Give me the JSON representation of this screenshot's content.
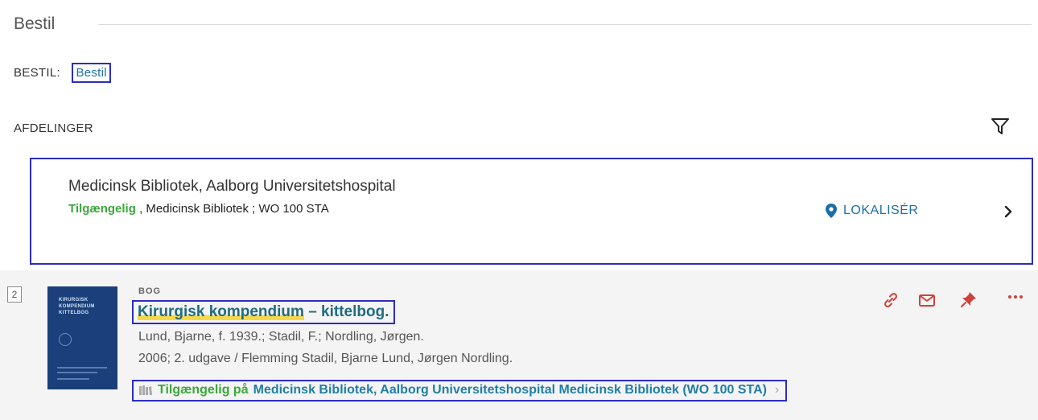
{
  "section": {
    "title": "Bestil"
  },
  "bestil": {
    "label": "BESTIL:",
    "link": "Bestil"
  },
  "afdelinger": {
    "label": "AFDELINGER"
  },
  "location": {
    "name": "Medicinsk Bibliotek, Aalborg Universitetshospital",
    "status": "Tilgængelig",
    "meta": " , Medicinsk Bibliotek ; WO 100 STA",
    "localize": "LOKALISÉR"
  },
  "result": {
    "number": "2",
    "type": "BOG",
    "title_highlight": "Kirurgisk kompendium",
    "title_rest": " – kittelbog.",
    "authors": "Lund, Bjarne, f. 1939.; Stadil, F.; Nordling, Jørgen.",
    "edition": "2006; 2. udgave / Flemming Stadil, Bjarne Lund, Jørgen Nordling.",
    "availability_status": "Tilgængelig på",
    "availability_location": "Medicinsk Bibliotek, Aalborg Universitetshospital  Medicinsk Bibliotek (WO 100 STA)",
    "availability_chevron": "›",
    "cover_title": "KIRURGISK\nKOMPENDIUM\nKITTELBOG"
  },
  "icons": {
    "filter": "filter-icon",
    "location_pin": "location-pin-icon",
    "chevron": "chevron-right-icon",
    "link": "link-icon",
    "email": "email-icon",
    "pin": "pin-icon",
    "more": "more-icon",
    "book": "book-icon"
  },
  "colors": {
    "accent": "#2c2cc4",
    "link_blue": "#1a6fa8",
    "available_green": "#3aa83a",
    "action_red": "#d0413c",
    "title_teal": "#1f6b82",
    "highlight": "#f6d94a"
  }
}
